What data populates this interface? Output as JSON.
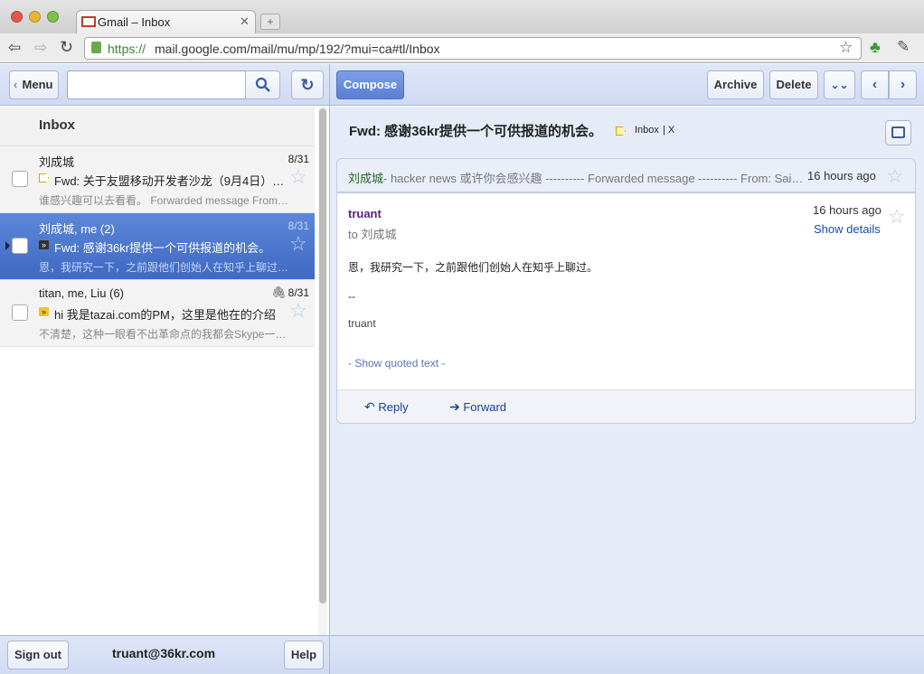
{
  "browser": {
    "tab_title": "Gmail – Inbox",
    "url_scheme": "https://",
    "url_rest": "mail.google.com/mail/mu/mp/192/?mui=ca#tl/Inbox"
  },
  "toolbar": {
    "menu_label": "Menu",
    "compose_label": "Compose",
    "archive_label": "Archive",
    "delete_label": "Delete",
    "search_placeholder": ""
  },
  "inbox": {
    "title": "Inbox",
    "threads": [
      {
        "from": "刘成城",
        "date": "8/31",
        "subject": "Fwd: 关于友盟移动开发者沙龙（9月4日）…",
        "snippet": "谁感兴趣可以去看看。 Forwarded message From…",
        "marker": "label"
      },
      {
        "from": "刘成城, me (2)",
        "date": "8/31",
        "subject": "Fwd: 感谢36kr提供一个可供报道的机会。",
        "snippet": "恩，我研究一下，之前跟他们创始人在知乎上聊过…",
        "marker": "important"
      },
      {
        "from": "titan, me, Liu (6)",
        "date": "8/31",
        "subject": "hi 我是tazai.com的PM，这里是他在的介绍",
        "snippet": "不清楚，这种一眼看不出革命点的我都会Skype一…",
        "marker": "important"
      }
    ]
  },
  "conversation": {
    "subject": "Fwd: 感谢36kr提供一个可供报道的机会。",
    "label": "Inbox",
    "label_close": "| X",
    "collapsed": {
      "sender": "刘成城",
      "preview": " - hacker news 或许你会感兴趣 ---------- Forwarded message ---------- From: Sai…",
      "time": "16 hours ago"
    },
    "message": {
      "sender": "truant",
      "to": "to 刘成城",
      "time": "16 hours ago",
      "show_details": "Show details",
      "body_line1": "恩，我研究一下，之前跟他们创始人在知乎上聊过。",
      "sig_dash": "--",
      "signature": "truant",
      "show_quoted": "- Show quoted text -"
    },
    "reply_label": "Reply",
    "forward_label": "Forward"
  },
  "footer": {
    "signout_label": "Sign out",
    "account": "truant@36kr.com",
    "help_label": "Help"
  },
  "colors": {
    "accent": "#4a74cc",
    "sender_green": "#226622",
    "link_blue": "#1a4ab5"
  }
}
